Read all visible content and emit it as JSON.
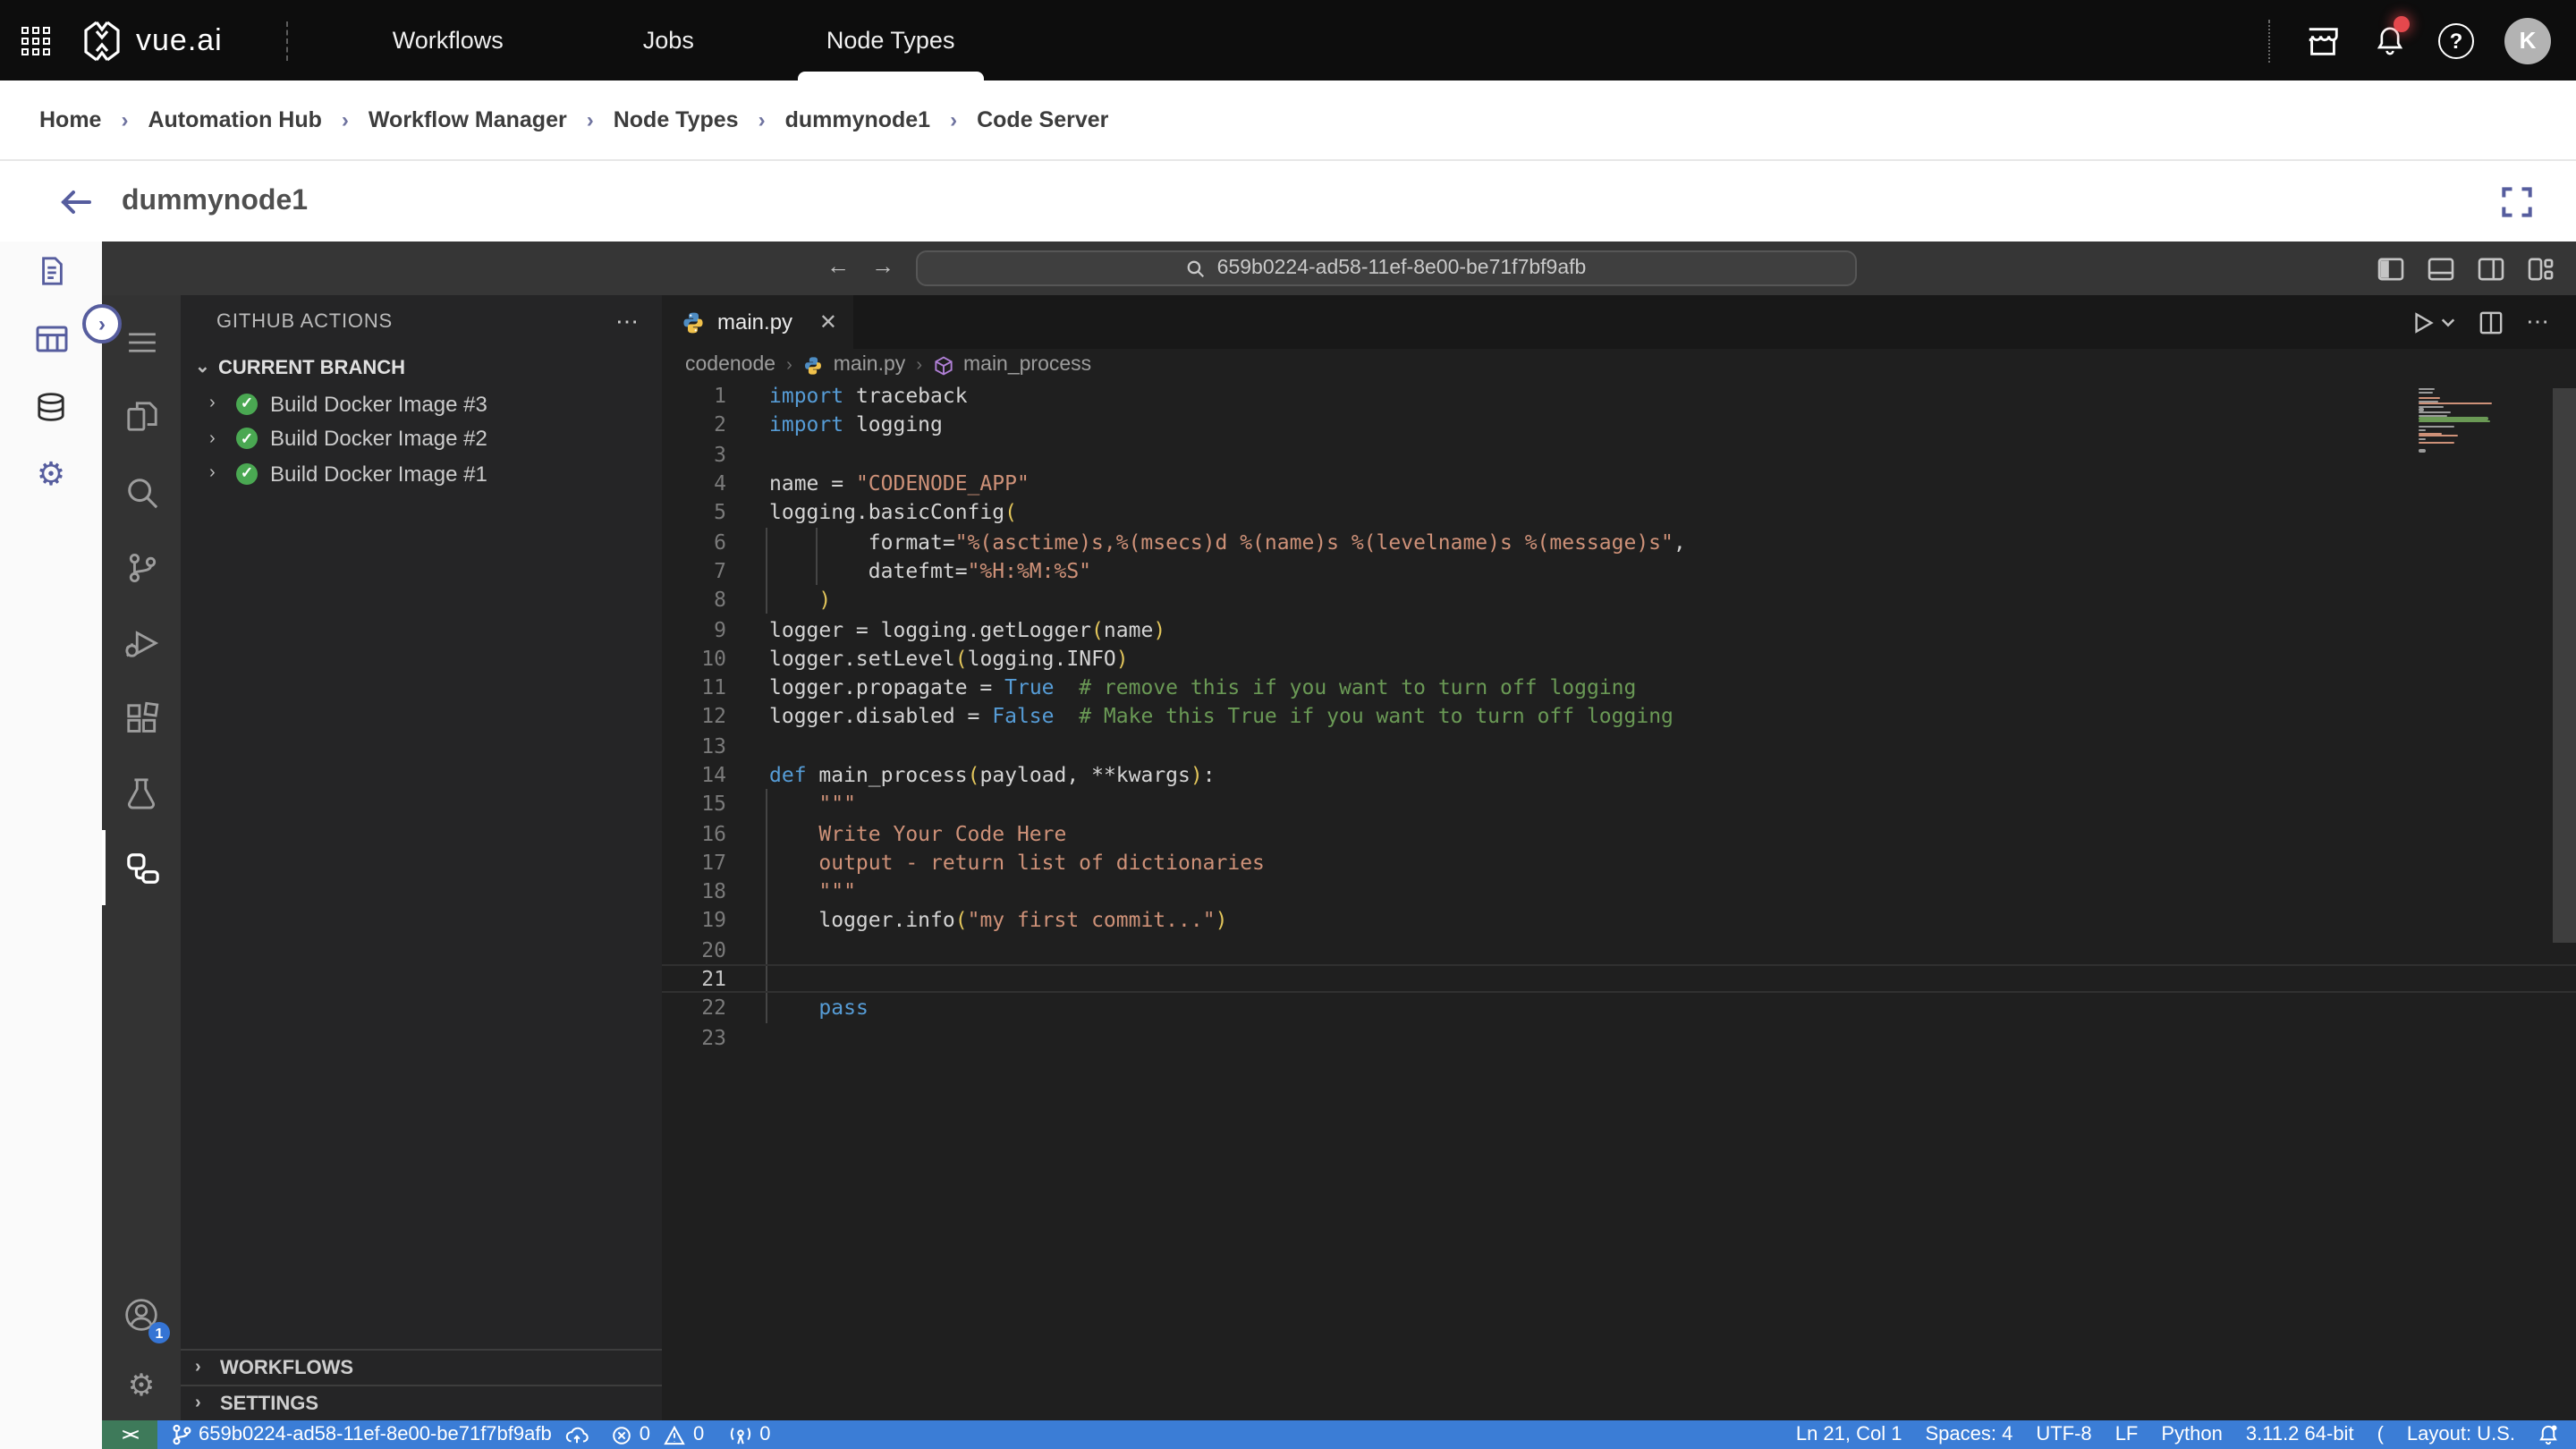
{
  "nav": {
    "brand": "vue.ai",
    "tabs": [
      {
        "label": "Workflows"
      },
      {
        "label": "Jobs"
      },
      {
        "label": "Node Types"
      }
    ],
    "avatar_initial": "K"
  },
  "breadcrumb": {
    "items": [
      "Home",
      "Automation Hub",
      "Workflow Manager",
      "Node Types",
      "dummynode1",
      "Code Server"
    ]
  },
  "header": {
    "title": "dummynode1"
  },
  "code_server": {
    "command_center": "659b0224-ad58-11ef-8e00-be71f7bf9afb",
    "panel": {
      "title": "GITHUB ACTIONS",
      "section": "CURRENT BRANCH",
      "runs": [
        "Build Docker Image #3",
        "Build Docker Image #2",
        "Build Docker Image #1"
      ],
      "bottom_sections": [
        "WORKFLOWS",
        "SETTINGS"
      ]
    },
    "tab": {
      "name": "main.py"
    },
    "crumbs": [
      "codenode",
      "main.py",
      "main_process"
    ],
    "editor": {
      "current_line": 21,
      "lines": [
        [
          [
            "k",
            "import"
          ],
          [
            "t",
            " traceback"
          ]
        ],
        [
          [
            "k",
            "import"
          ],
          [
            "t",
            " logging"
          ]
        ],
        [],
        [
          [
            "t",
            "name = "
          ],
          [
            "s",
            "\"CODENODE_APP\""
          ]
        ],
        [
          [
            "t",
            "logging.basicConfig"
          ],
          [
            "p",
            "("
          ]
        ],
        [
          [
            "t",
            "        format="
          ],
          [
            "s",
            "\"%(asctime)s,%(msecs)d %(name)s %(levelname)s %(message)s\""
          ],
          [
            "t",
            ","
          ]
        ],
        [
          [
            "t",
            "        datefmt="
          ],
          [
            "s",
            "\"%H:%M:%S\""
          ]
        ],
        [
          [
            "t",
            "    "
          ],
          [
            "p",
            ")"
          ]
        ],
        [
          [
            "t",
            "logger = logging.getLogger"
          ],
          [
            "p",
            "("
          ],
          [
            "t",
            "name"
          ],
          [
            "p",
            ")"
          ]
        ],
        [
          [
            "t",
            "logger.setLevel"
          ],
          [
            "p",
            "("
          ],
          [
            "t",
            "logging.INFO"
          ],
          [
            "p",
            ")"
          ]
        ],
        [
          [
            "t",
            "logger.propagate = "
          ],
          [
            "k",
            "True"
          ],
          [
            "t",
            "  "
          ],
          [
            "c",
            "# remove this if you want to turn off logging"
          ]
        ],
        [
          [
            "t",
            "logger.disabled = "
          ],
          [
            "k",
            "False"
          ],
          [
            "t",
            "  "
          ],
          [
            "c",
            "# Make this True if you want to turn off logging"
          ]
        ],
        [],
        [
          [
            "k",
            "def"
          ],
          [
            "t",
            " main_process"
          ],
          [
            "p",
            "("
          ],
          [
            "t",
            "payload, **kwargs"
          ],
          [
            "p",
            ")"
          ],
          [
            "t",
            ":"
          ]
        ],
        [
          [
            "t",
            "    "
          ],
          [
            "s",
            "\"\"\""
          ]
        ],
        [
          [
            "s",
            "    Write Your Code Here"
          ]
        ],
        [
          [
            "s",
            "    output - return list of dictionaries"
          ]
        ],
        [
          [
            "t",
            "    "
          ],
          [
            "s",
            "\"\"\""
          ]
        ],
        [
          [
            "t",
            "    logger.info"
          ],
          [
            "p",
            "("
          ],
          [
            "s",
            "\"my first commit...\""
          ],
          [
            "p",
            ")"
          ]
        ],
        [],
        [],
        [
          [
            "t",
            "    "
          ],
          [
            "k",
            "pass"
          ]
        ],
        []
      ]
    },
    "status": {
      "remote": "><",
      "branch": "659b0224-ad58-11ef-8e00-be71f7bf9afb",
      "errors": "0",
      "warnings": "0",
      "ports": "0",
      "line_col": "Ln 21, Col 1",
      "spaces": "Spaces: 4",
      "encoding": "UTF-8",
      "eol": "LF",
      "language": "Python",
      "runtime": "3.11.2 64-bit",
      "spinner": "(",
      "layout": "Layout: U.S."
    },
    "account_badge": "1"
  },
  "colors": {
    "accent_purple": "#565d9e",
    "status_blue": "#3b7dd6",
    "remote_green": "#3e7a5a",
    "success_green": "#4aa852",
    "notification_red": "#e5484d"
  }
}
